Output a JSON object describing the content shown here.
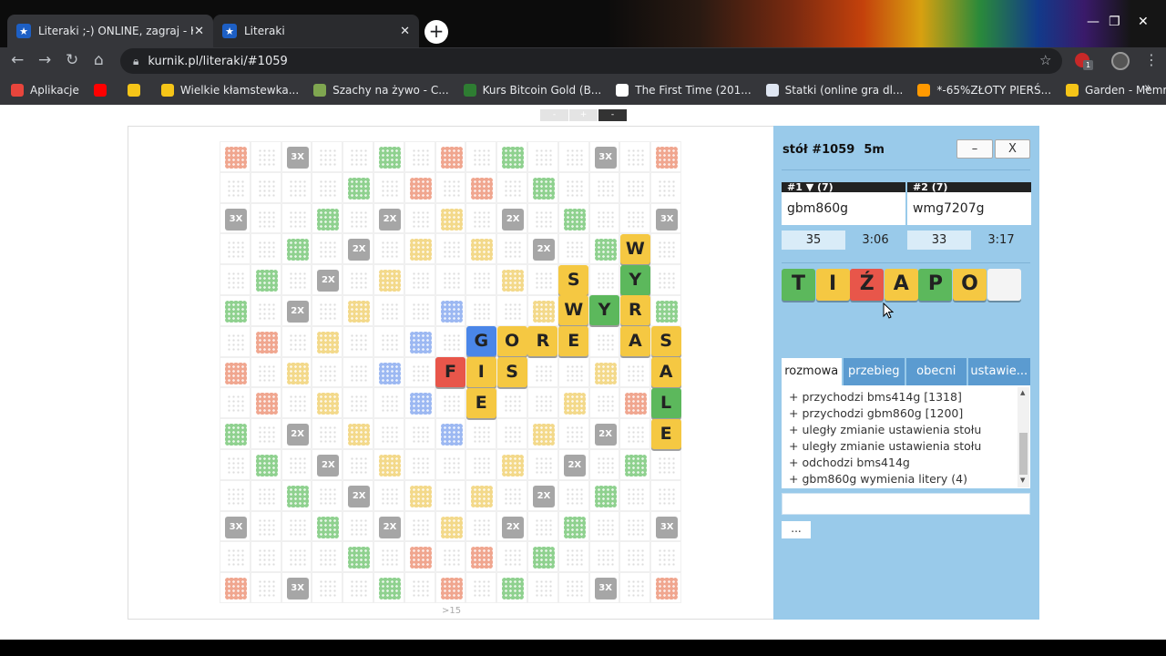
{
  "browser": {
    "tabs": [
      {
        "title": "Literaki ;-) ONLINE, zagraj - Kurnik",
        "active": true
      },
      {
        "title": "Literaki",
        "active": false
      }
    ],
    "url": "kurnik.pl/literaki/#1059",
    "bookmarks": [
      {
        "label": "Aplikacje",
        "icon": "apps-grid-icon",
        "color": "#e8453c"
      },
      {
        "label": "",
        "icon": "youtube-icon",
        "color": "#ff0000"
      },
      {
        "label": "",
        "icon": "chrome-extension-icon",
        "color": "#f5c518"
      },
      {
        "label": "Wielkie kłamstewka...",
        "icon": "film-reel-icon",
        "color": "#f5c518"
      },
      {
        "label": "Szachy na żywo - C...",
        "icon": "chess-pawn-icon",
        "color": "#7fa650"
      },
      {
        "label": "Kurs Bitcoin Gold (B...",
        "icon": "chart-icon",
        "color": "#2e7d32"
      },
      {
        "label": "The First Time (201...",
        "icon": "wikipedia-icon",
        "color": "#ffffff"
      },
      {
        "label": "Statki (online gra dl...",
        "icon": "ships-icon",
        "color": "#dfe6f2"
      },
      {
        "label": "*-65%ZŁOTY PIERŚ...",
        "icon": "amazon-icon",
        "color": "#ff9900"
      },
      {
        "label": "Garden - Memrise",
        "icon": "memrise-icon",
        "color": "#f5c518"
      }
    ]
  },
  "zoom": [
    "-",
    "+",
    "-"
  ],
  "board": {
    "note": ">15",
    "colors": {
      "red": "#f0a68f",
      "yellow": "#f3d98a",
      "green": "#8fd18f",
      "blue": "#9cb8f2",
      "gray": "#a6a6a6"
    },
    "bonuses": [
      [
        0,
        0,
        "red"
      ],
      [
        2,
        0,
        "3X"
      ],
      [
        5,
        0,
        "green"
      ],
      [
        7,
        0,
        "red"
      ],
      [
        9,
        0,
        "green"
      ],
      [
        12,
        0,
        "3X"
      ],
      [
        14,
        0,
        "red"
      ],
      [
        4,
        1,
        "green"
      ],
      [
        6,
        1,
        "red"
      ],
      [
        8,
        1,
        "red"
      ],
      [
        10,
        1,
        "green"
      ],
      [
        0,
        2,
        "3X"
      ],
      [
        3,
        2,
        "green"
      ],
      [
        5,
        2,
        "2X"
      ],
      [
        7,
        2,
        "yellow"
      ],
      [
        9,
        2,
        "2X"
      ],
      [
        11,
        2,
        "green"
      ],
      [
        14,
        2,
        "3X"
      ],
      [
        2,
        3,
        "green"
      ],
      [
        4,
        3,
        "2X"
      ],
      [
        6,
        3,
        "yellow"
      ],
      [
        8,
        3,
        "yellow"
      ],
      [
        10,
        3,
        "2X"
      ],
      [
        12,
        3,
        "green"
      ],
      [
        1,
        4,
        "green"
      ],
      [
        3,
        4,
        "2X"
      ],
      [
        5,
        4,
        "yellow"
      ],
      [
        9,
        4,
        "yellow"
      ],
      [
        0,
        5,
        "green"
      ],
      [
        2,
        5,
        "2X"
      ],
      [
        4,
        5,
        "yellow"
      ],
      [
        7,
        5,
        "blue"
      ],
      [
        10,
        5,
        "yellow"
      ],
      [
        14,
        5,
        "green"
      ],
      [
        1,
        6,
        "red"
      ],
      [
        3,
        6,
        "yellow"
      ],
      [
        6,
        6,
        "blue"
      ],
      [
        0,
        7,
        "red"
      ],
      [
        2,
        7,
        "yellow"
      ],
      [
        5,
        7,
        "blue"
      ],
      [
        12,
        7,
        "yellow"
      ],
      [
        1,
        8,
        "red"
      ],
      [
        3,
        8,
        "yellow"
      ],
      [
        6,
        8,
        "blue"
      ],
      [
        11,
        8,
        "yellow"
      ],
      [
        13,
        8,
        "red"
      ],
      [
        0,
        9,
        "green"
      ],
      [
        2,
        9,
        "2X"
      ],
      [
        4,
        9,
        "yellow"
      ],
      [
        7,
        9,
        "blue"
      ],
      [
        10,
        9,
        "yellow"
      ],
      [
        12,
        9,
        "2X"
      ],
      [
        1,
        10,
        "green"
      ],
      [
        3,
        10,
        "2X"
      ],
      [
        5,
        10,
        "yellow"
      ],
      [
        9,
        10,
        "yellow"
      ],
      [
        11,
        10,
        "2X"
      ],
      [
        13,
        10,
        "green"
      ],
      [
        2,
        11,
        "green"
      ],
      [
        4,
        11,
        "2X"
      ],
      [
        6,
        11,
        "yellow"
      ],
      [
        8,
        11,
        "yellow"
      ],
      [
        10,
        11,
        "2X"
      ],
      [
        12,
        11,
        "green"
      ],
      [
        0,
        12,
        "3X"
      ],
      [
        3,
        12,
        "green"
      ],
      [
        5,
        12,
        "2X"
      ],
      [
        7,
        12,
        "yellow"
      ],
      [
        9,
        12,
        "2X"
      ],
      [
        11,
        12,
        "green"
      ],
      [
        14,
        12,
        "3X"
      ],
      [
        4,
        13,
        "green"
      ],
      [
        6,
        13,
        "red"
      ],
      [
        8,
        13,
        "red"
      ],
      [
        10,
        13,
        "green"
      ],
      [
        0,
        14,
        "red"
      ],
      [
        2,
        14,
        "3X"
      ],
      [
        5,
        14,
        "green"
      ],
      [
        7,
        14,
        "red"
      ],
      [
        9,
        14,
        "green"
      ],
      [
        12,
        14,
        "3X"
      ],
      [
        14,
        14,
        "red"
      ]
    ],
    "tiles": [
      {
        "c": 13,
        "r": 3,
        "l": "W",
        "col": "#f5c842"
      },
      {
        "c": 11,
        "r": 4,
        "l": "S",
        "col": "#f5c842"
      },
      {
        "c": 13,
        "r": 4,
        "l": "Y",
        "col": "#5cb85c"
      },
      {
        "c": 11,
        "r": 5,
        "l": "W",
        "col": "#f5c842"
      },
      {
        "c": 12,
        "r": 5,
        "l": "Y",
        "col": "#5cb85c"
      },
      {
        "c": 13,
        "r": 5,
        "l": "R",
        "col": "#f5c842"
      },
      {
        "c": 8,
        "r": 6,
        "l": "G",
        "col": "#4a86e8"
      },
      {
        "c": 9,
        "r": 6,
        "l": "O",
        "col": "#f5c842"
      },
      {
        "c": 10,
        "r": 6,
        "l": "R",
        "col": "#f5c842"
      },
      {
        "c": 11,
        "r": 6,
        "l": "E",
        "col": "#f5c842"
      },
      {
        "c": 13,
        "r": 6,
        "l": "A",
        "col": "#f5c842"
      },
      {
        "c": 14,
        "r": 6,
        "l": "S",
        "col": "#f5c842"
      },
      {
        "c": 7,
        "r": 7,
        "l": "F",
        "col": "#e8564a"
      },
      {
        "c": 8,
        "r": 7,
        "l": "I",
        "col": "#f5c842"
      },
      {
        "c": 9,
        "r": 7,
        "l": "S",
        "col": "#f5c842"
      },
      {
        "c": 14,
        "r": 7,
        "l": "A",
        "col": "#f5c842"
      },
      {
        "c": 8,
        "r": 8,
        "l": "E",
        "col": "#f5c842"
      },
      {
        "c": 14,
        "r": 8,
        "l": "L",
        "col": "#5cb85c"
      },
      {
        "c": 14,
        "r": 9,
        "l": "E",
        "col": "#f5c842"
      }
    ]
  },
  "panel": {
    "table_label": "stół #1059",
    "time_label": "5m",
    "minimize_label": "–",
    "close_label": "X",
    "players": [
      {
        "head": "#1 ▼ (7)",
        "name": "gbm860g",
        "score": "35",
        "time": "3:06"
      },
      {
        "head": "#2   (7)",
        "name": "wmg7207g",
        "score": "33",
        "time": "3:17"
      }
    ],
    "rack": [
      {
        "l": "T",
        "col": "#5cb85c"
      },
      {
        "l": "I",
        "col": "#f5c842"
      },
      {
        "l": "Ź",
        "col": "#e8564a"
      },
      {
        "l": "A",
        "col": "#f5c842"
      },
      {
        "l": "P",
        "col": "#5cb85c"
      },
      {
        "l": "O",
        "col": "#f5c842"
      },
      {
        "l": "",
        "col": "#f4f4f4"
      }
    ],
    "tabs": [
      "rozmowa",
      "przebieg",
      "obecni",
      "ustawie..."
    ],
    "chat": [
      "+ przychodzi bms414g [1318]",
      "+ przychodzi gbm860g [1200]",
      "+ uległy zmianie ustawienia stołu",
      "+ uległy zmianie ustawienia stołu",
      "+ odchodzi bms414g",
      "+ gbm860g wymienia litery (4)"
    ],
    "more_label": "..."
  }
}
